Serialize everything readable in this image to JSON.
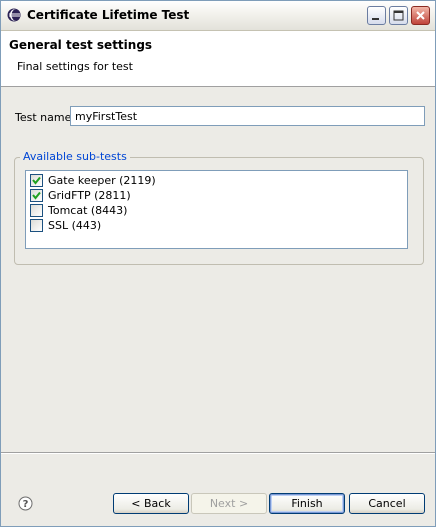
{
  "window": {
    "title": "Certificate Lifetime Test"
  },
  "header": {
    "title": "General test settings",
    "description": "Final settings for test"
  },
  "form": {
    "test_name_label": "Test name",
    "test_name_value": "myFirstTest",
    "subtests_label": "Available sub-tests",
    "subtests": [
      {
        "label": "Gate keeper (2119)",
        "checked": true
      },
      {
        "label": "GridFTP (2811)",
        "checked": true
      },
      {
        "label": "Tomcat (8443)",
        "checked": false
      },
      {
        "label": "SSL (443)",
        "checked": false
      }
    ]
  },
  "buttons": {
    "back": "< Back",
    "next": "Next >",
    "finish": "Finish",
    "cancel": "Cancel"
  },
  "icons": {
    "help": "help-icon",
    "app": "eclipse-icon",
    "minimize": "minimize-icon",
    "maximize": "maximize-icon",
    "close": "close-icon"
  },
  "colors": {
    "accent": "#0046d5",
    "check": "#21a121",
    "close_button": "#c0433a"
  }
}
